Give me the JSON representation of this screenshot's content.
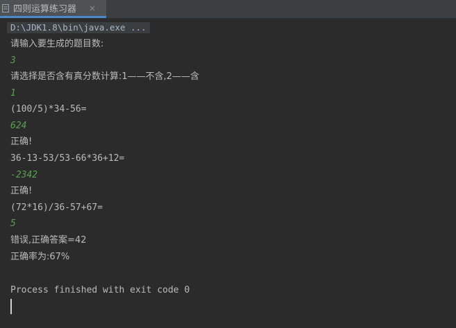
{
  "tab": {
    "title": "四则运算练习器",
    "close_glyph": "×"
  },
  "console": {
    "command": "D:\\JDK1.8\\bin\\java.exe ...",
    "lines": [
      {
        "text": "请输入要生成的题目数:",
        "type": "output"
      },
      {
        "text": "3",
        "type": "input"
      },
      {
        "text": "请选择是否含有真分数计算:1——不含,2——含",
        "type": "output"
      },
      {
        "text": "1",
        "type": "input"
      },
      {
        "text": "(100/5)*34-56=",
        "type": "output"
      },
      {
        "text": "624",
        "type": "input"
      },
      {
        "text": "正确!",
        "type": "output"
      },
      {
        "text": "36-13-53/53-66*36+12=",
        "type": "output"
      },
      {
        "text": "-2342",
        "type": "input"
      },
      {
        "text": "正确!",
        "type": "output"
      },
      {
        "text": "(72*16)/36-57+67=",
        "type": "output"
      },
      {
        "text": "5",
        "type": "input"
      },
      {
        "text": "错误,正确答案=42",
        "type": "output"
      },
      {
        "text": "正确率为:67%",
        "type": "output"
      }
    ],
    "finish_message": "Process finished with exit code 0"
  },
  "colors": {
    "background": "#2b2b2b",
    "output_text": "#bbbbbb",
    "input_text": "#58a14e",
    "tab_underline": "#4a88c7"
  },
  "icons": {
    "tab": "java-file-icon",
    "close": "close-icon"
  }
}
